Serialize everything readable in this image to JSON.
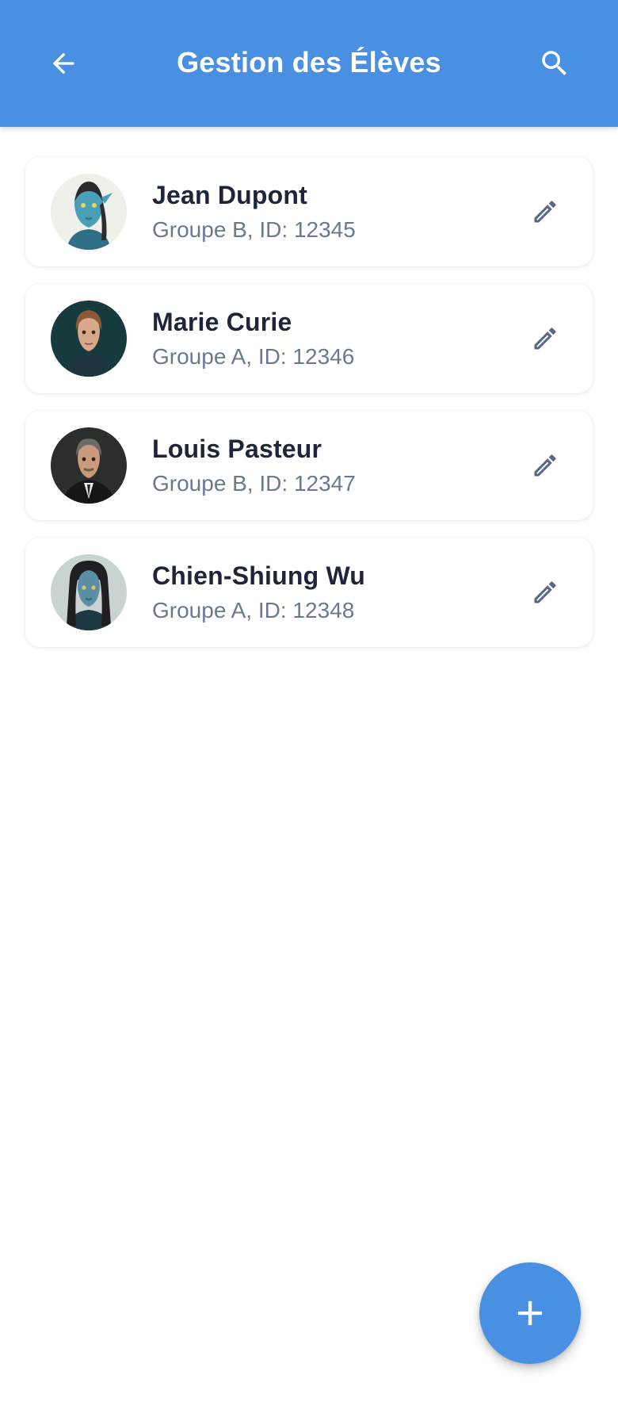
{
  "header": {
    "title": "Gestion des Élèves",
    "back_icon": "arrow-left-icon",
    "search_icon": "search-icon",
    "color": "#4A90E2"
  },
  "students": [
    {
      "name": "Jean Dupont",
      "details": "Groupe B, ID: 12345",
      "avatar": "blue-alien-male-avatar"
    },
    {
      "name": "Marie Curie",
      "details": "Groupe A, ID: 12346",
      "avatar": "woman-portrait-avatar"
    },
    {
      "name": "Louis Pasteur",
      "details": "Groupe B, ID: 12347",
      "avatar": "man-in-suit-avatar"
    },
    {
      "name": "Chien-Shiung Wu",
      "details": "Groupe A, ID: 12348",
      "avatar": "blue-alien-female-avatar"
    }
  ],
  "edit_icon": "pencil-icon",
  "fab": {
    "icon": "plus-icon",
    "color": "#4A90E2"
  }
}
